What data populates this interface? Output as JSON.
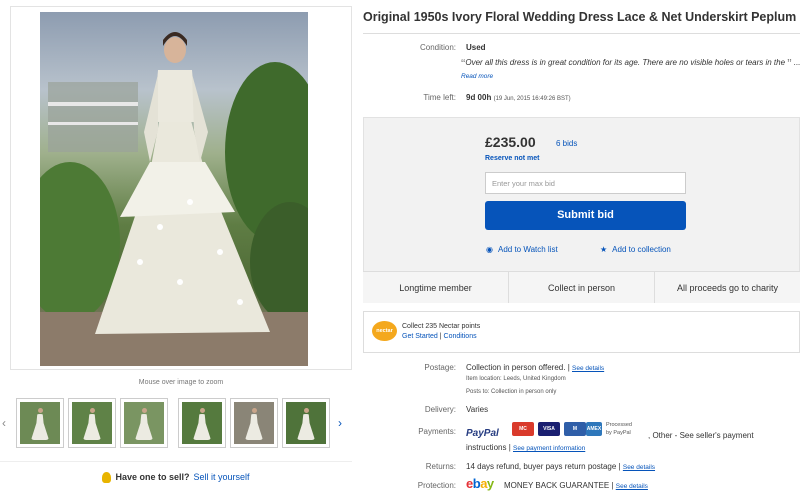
{
  "listing": {
    "title": "Original 1950s Ivory Floral Wedding Dress Lace & Net Underskirt Peplum"
  },
  "gallery": {
    "zoom_hint": "Mouse over image to zoom",
    "thumb_count": 6,
    "sell_label": "Have one to sell?",
    "sell_link": "Sell it yourself"
  },
  "details": {
    "condition_label": "Condition:",
    "condition_value": "Used",
    "condition_quote": "Over all this dress is in great condition for its age. There are no visible holes or tears in the",
    "read_more": "Read more",
    "time_left_label": "Time left:",
    "time_left_value": "9d 00h",
    "time_left_date": "(19 Jun, 2015  16:49:26 BST)"
  },
  "bidding": {
    "price": "£235.00",
    "bids": "6 bids",
    "reserve": "Reserve not met",
    "max_bid_placeholder": "Enter your max bid",
    "submit_label": "Submit bid",
    "watch_label": "Add to Watch list",
    "collection_label": "Add to collection"
  },
  "features": [
    "Longtime member",
    "Collect in person",
    "All proceeds go to charity"
  ],
  "nectar": {
    "logo": "nectar",
    "line1": "Collect 235 Nectar points",
    "get_started": "Get Started",
    "conditions": "Conditions"
  },
  "shipping": {
    "postage_label": "Postage:",
    "postage_value": "Collection in person offered.",
    "see_details": "See details",
    "location": "Item location:  Leeds, United Kingdom",
    "posts_to": "Posts to:  Collection in person only",
    "delivery_label": "Delivery:",
    "delivery_value": "Varies",
    "payments_label": "Payments:",
    "paypal_logo": "PayPal",
    "processed_by": "Processed by PayPal",
    "payments_other": ", Other - See seller's payment",
    "payments_instructions": "instructions",
    "see_payment": "See payment information",
    "returns_label": "Returns:",
    "returns_value": "14 days refund, buyer pays return postage",
    "protection_label": "Protection:",
    "ebay_logo": "ebay",
    "guarantee": "MONEY BACK GUARANTEE",
    "see_details_2": "See details"
  },
  "cards": [
    {
      "name": "mastercard",
      "label": "MC",
      "color": "#d93a2b"
    },
    {
      "name": "visa",
      "label": "VISA",
      "color": "#1a1f71"
    },
    {
      "name": "maestro",
      "label": "M",
      "color": "#2f5ea8"
    },
    {
      "name": "amex",
      "label": "AMEX",
      "color": "#2e77bb"
    }
  ],
  "colors": {
    "accent": "#0654ba",
    "nectar": "#f4a81d"
  }
}
